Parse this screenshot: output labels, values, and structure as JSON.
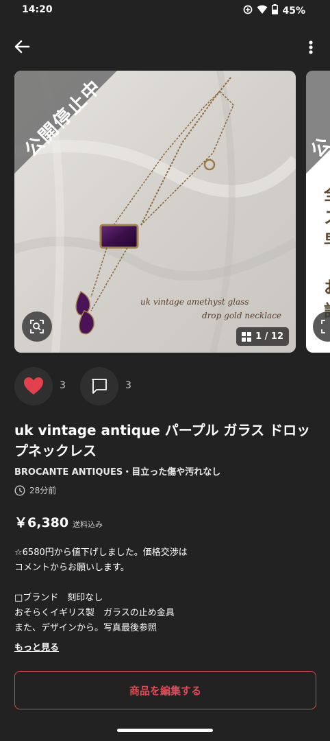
{
  "status_bar": {
    "time": "14:20",
    "battery": "45%",
    "icons": [
      "data-saver-icon",
      "wifi-icon",
      "battery-icon"
    ]
  },
  "topbar": {
    "icons": [
      "back-arrow-icon",
      "more-vert-icon"
    ]
  },
  "gallery": {
    "banner": "公開停止中",
    "caption_line1": "uk vintage amethyst glass",
    "caption_line2": "drop gold necklace",
    "counter": "1 / 12",
    "next_banner": "公",
    "next_text": [
      "全",
      "ス",
      "早",
      "",
      "お",
      "話"
    ]
  },
  "actions": {
    "like_count": "3",
    "comment_count": "3",
    "like_color": "#e2404c"
  },
  "item": {
    "title": "uk vintage antique パープル ガラス ドロップネックレス",
    "shop": "BROCANTE ANTIQUES・目立った傷や汚れなし",
    "posted": "28分前",
    "price": "￥6,380",
    "shipping": "送料込み",
    "description": "☆6580円から値下げしました。価格交渉は\nコメントからお願いします。\n\n□ブランド　刻印なし\nおそらくイギリス製　ガラスの止め金具\nまた、デザインから。写真最後参照",
    "more_link": "もっと見る"
  },
  "edit_button": "商品を編集する",
  "colors": {
    "background": "#222222",
    "accent": "#e24a55"
  }
}
